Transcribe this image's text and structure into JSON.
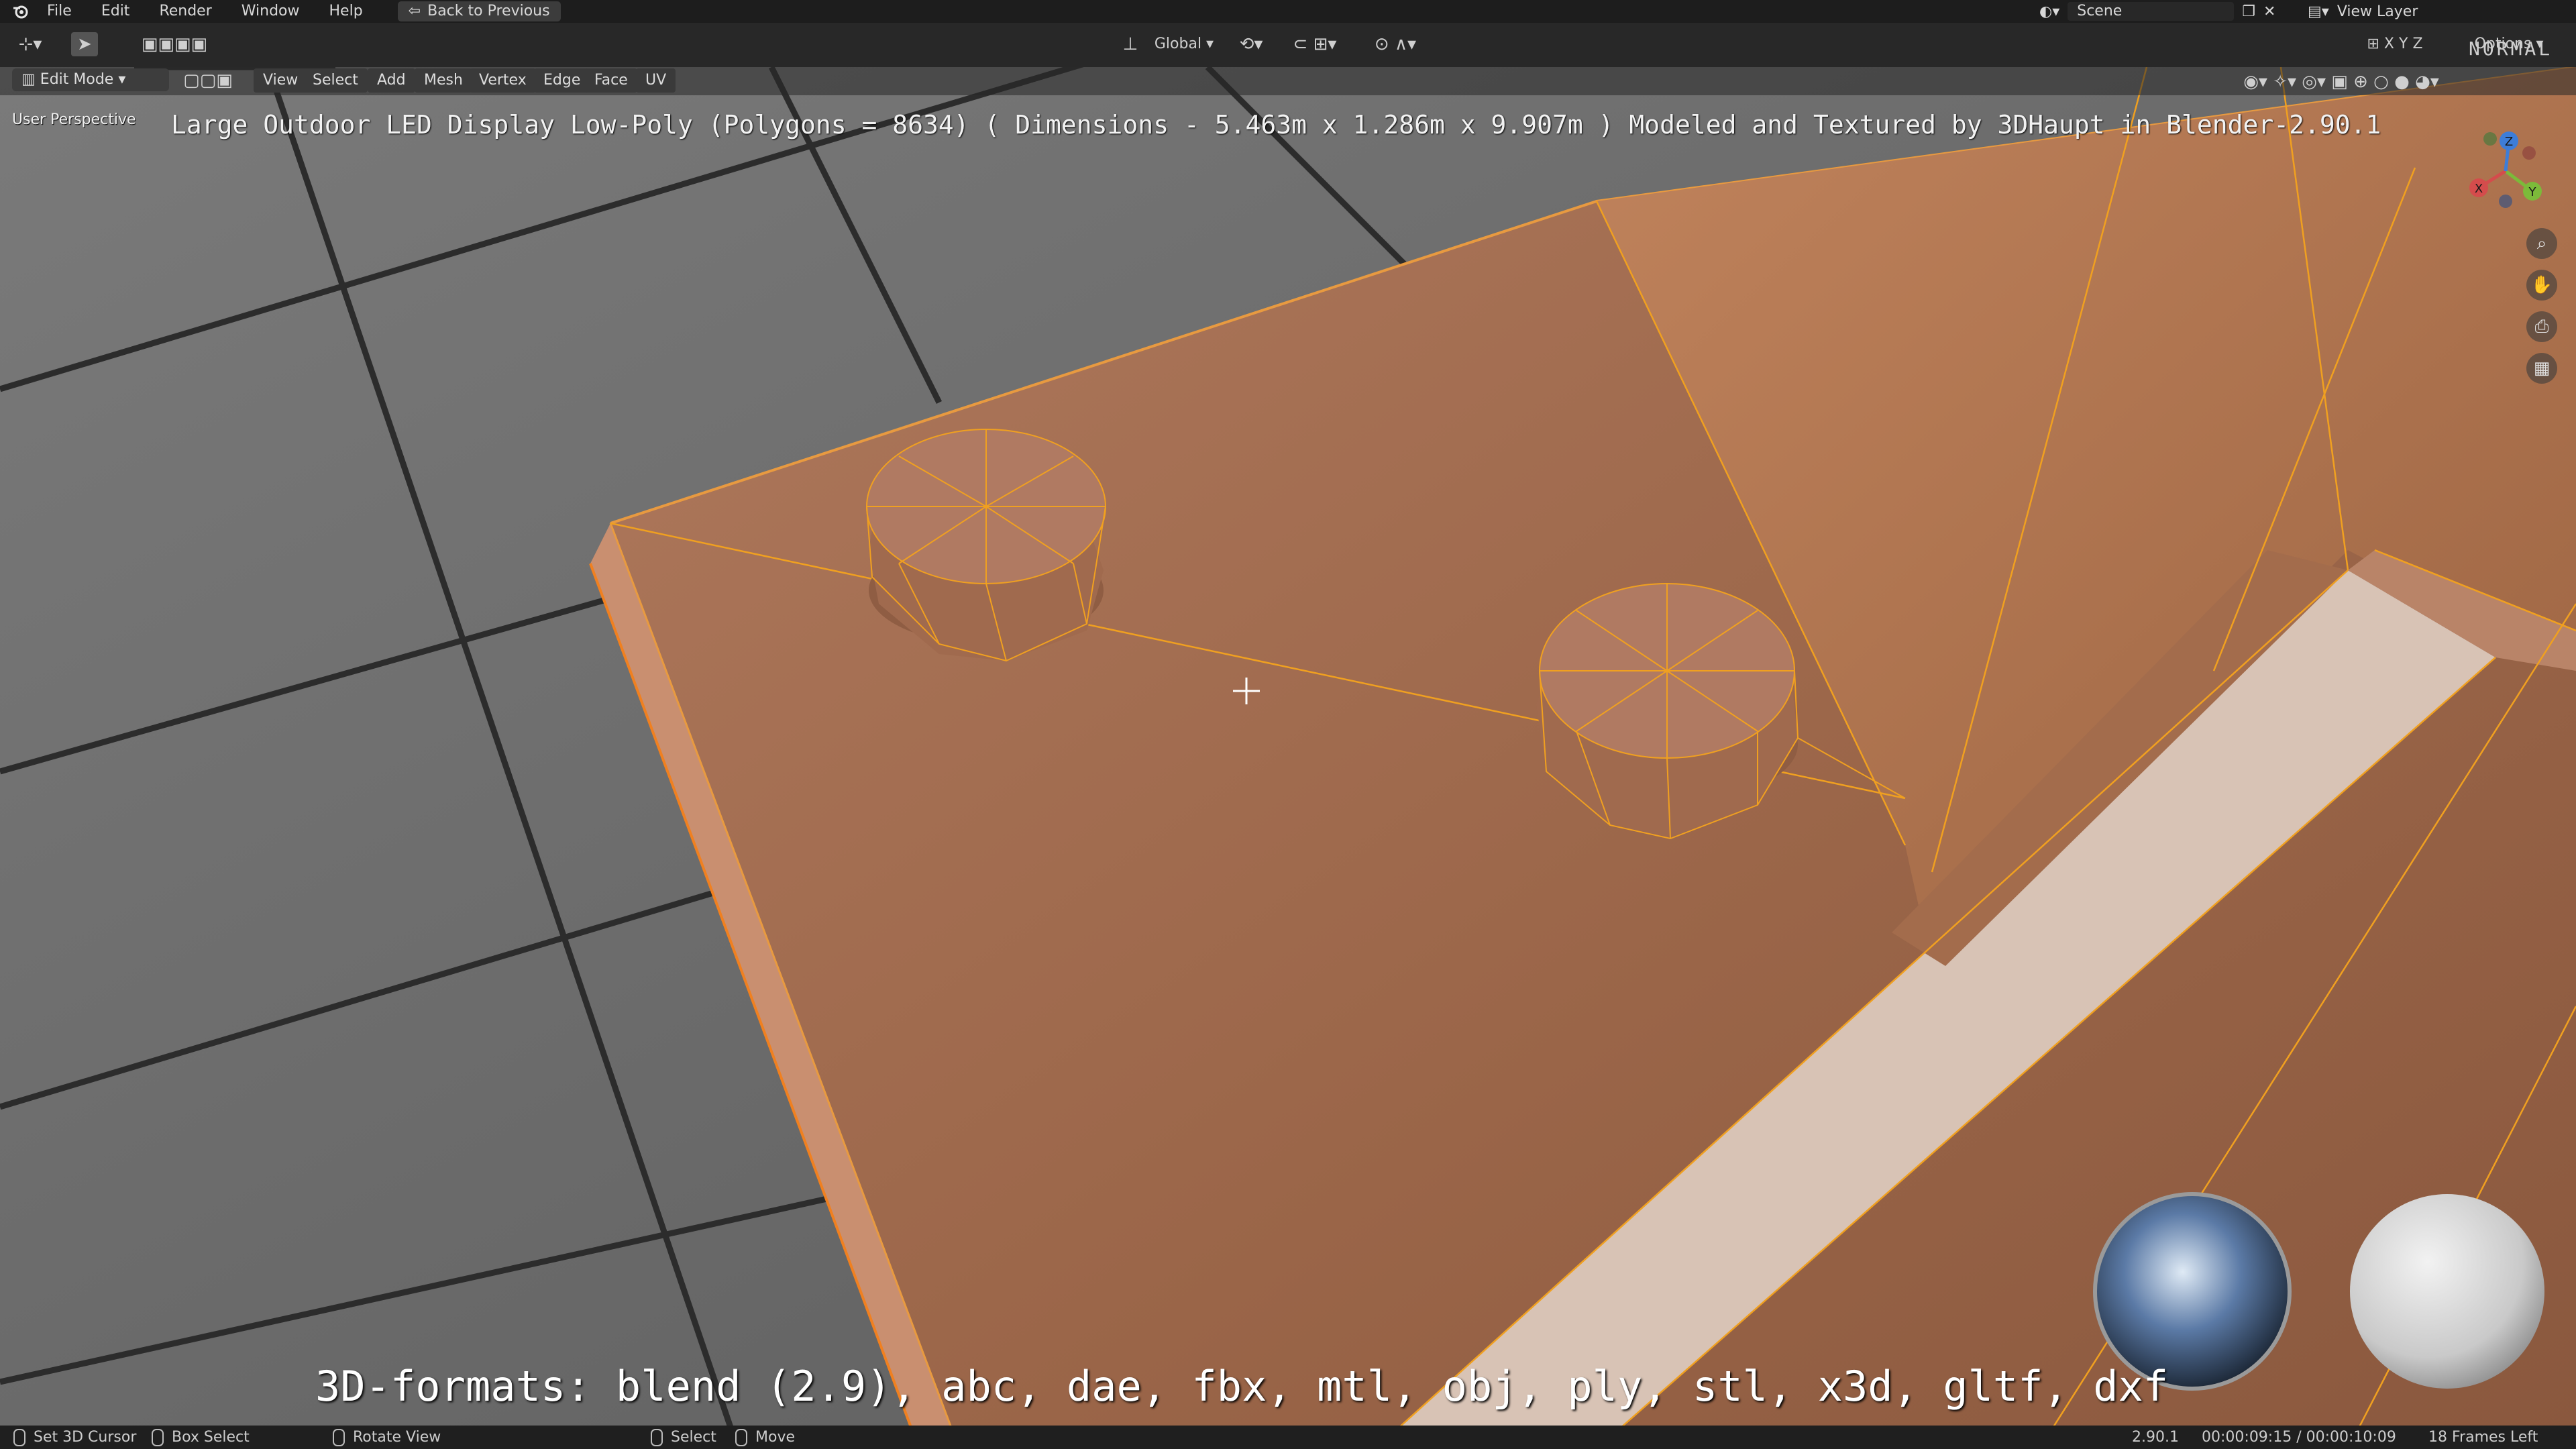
{
  "menu": {
    "items": [
      "File",
      "Edit",
      "Render",
      "Window",
      "Help"
    ],
    "back_button": "Back to Previous"
  },
  "scene": {
    "label": "Scene",
    "view_layer": "View Layer"
  },
  "header": {
    "orientation": "Global",
    "options": "Options",
    "normal_tag": "NORMAL"
  },
  "viewport_header": {
    "mode": "Edit Mode",
    "menus": [
      "View",
      "Select",
      "Add",
      "Mesh",
      "Vertex",
      "Edge",
      "Face",
      "UV"
    ],
    "axes": [
      "X",
      "Y",
      "Z"
    ]
  },
  "viewport": {
    "view_name": "User Perspective",
    "title_overlay": "Large Outdoor LED Display Low-Poly (Polygons = 8634) ( Dimensions -  5.463m x 1.286m x 9.907m ) Modeled and Textured by 3DHaupt in Blender-2.90.1",
    "formats_overlay": "3D-formats: blend (2.9), abc, dae, fbx, mtl, obj, ply, stl, x3d, gltf, dxf"
  },
  "gizmo": {
    "x": "X",
    "y": "Y",
    "z": "Z"
  },
  "status": {
    "set_cursor": "Set 3D Cursor",
    "box_select": "Box Select",
    "rotate_view": "Rotate View",
    "select": "Select",
    "move": "Move",
    "version": "2.90.1",
    "time": "00:00:09:15 / 00:00:10:09",
    "frames_left": "18 Frames Left"
  },
  "colors": {
    "accent_orange": "#f0a020",
    "object_surface": "#a06a4e",
    "pavement": "#6e6e6e"
  }
}
